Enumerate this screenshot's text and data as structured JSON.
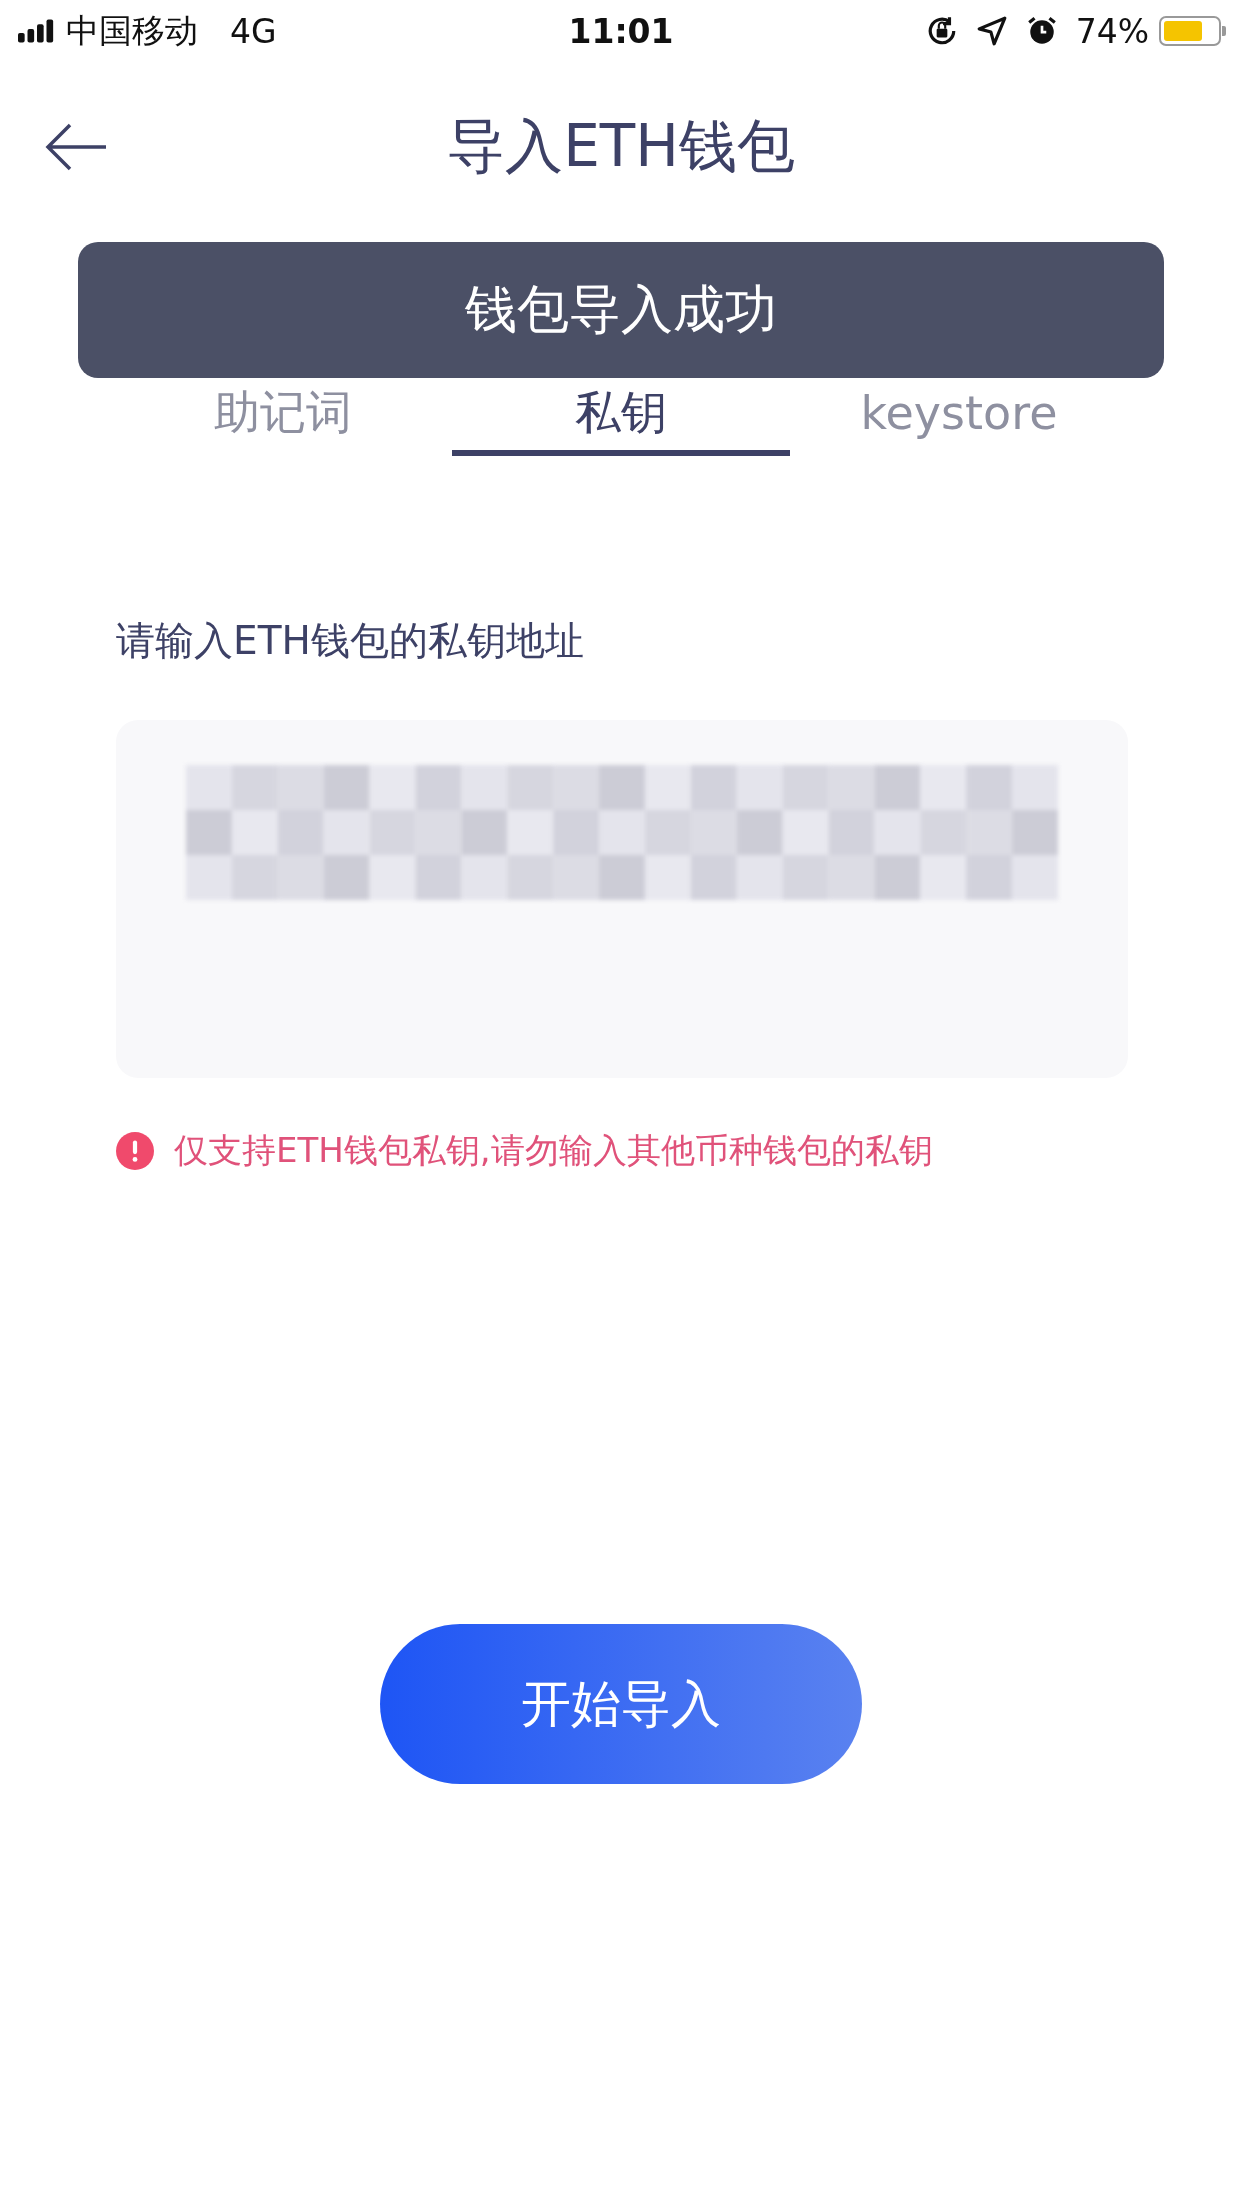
{
  "status_bar": {
    "carrier": "中国移动",
    "network": "4G",
    "time": "11:01",
    "battery_percent": "74%",
    "battery": {
      "level": 0.74
    }
  },
  "header": {
    "title": "导入ETH钱包"
  },
  "toast": {
    "text": "钱包导入成功"
  },
  "tabs": [
    {
      "label": "助记词",
      "selected": false
    },
    {
      "label": "私钥",
      "selected": true
    },
    {
      "label": "keystore",
      "selected": false
    }
  ],
  "form": {
    "label": "请输入ETH钱包的私钥地址",
    "field": {
      "redacted": true
    },
    "warning": "仅支持ETH钱包私钥,请勿输入其他币种钱包的私钥"
  },
  "button": {
    "label": "开始导入"
  }
}
